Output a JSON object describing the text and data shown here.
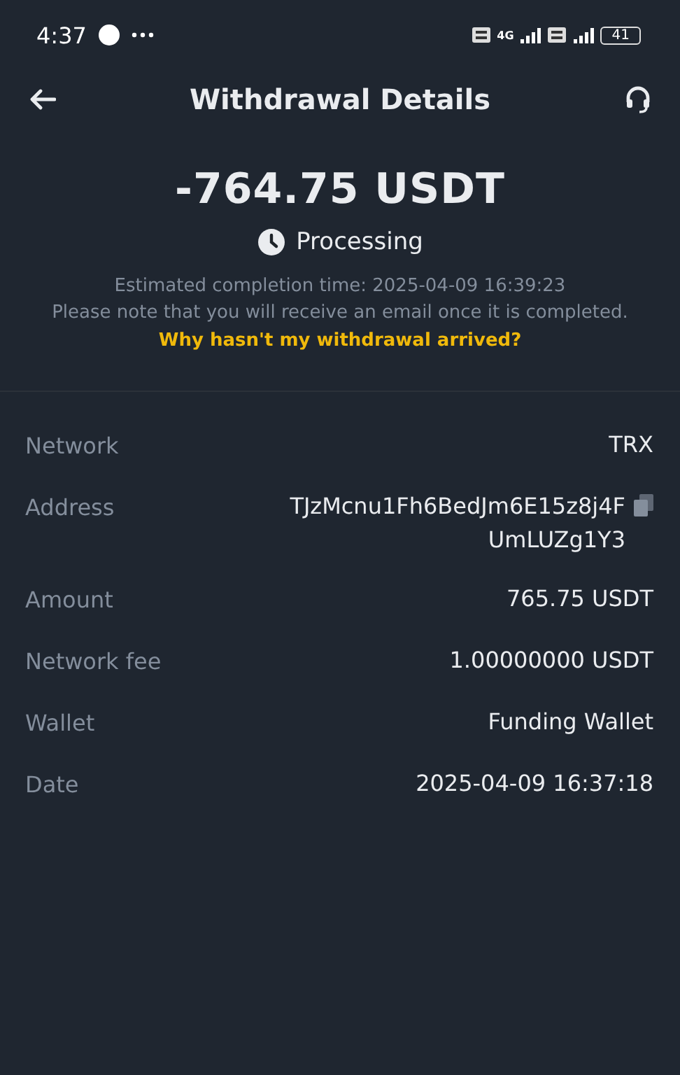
{
  "status_bar": {
    "time": "4:37",
    "network": "4G",
    "battery": "41"
  },
  "header": {
    "title": "Withdrawal Details"
  },
  "summary": {
    "amount": "-764.75 USDT",
    "status": "Processing",
    "estimate": "Estimated completion time: 2025-04-09 16:39:23",
    "note": "Please note that you will receive an email once it is completed.",
    "help_link": "Why hasn't my withdrawal arrived?"
  },
  "details": [
    {
      "label": "Network",
      "value": [
        "TRX"
      ],
      "copyable": false
    },
    {
      "label": "Address",
      "value": [
        "TJzMcnu1Fh6BedJm6E15z8j4F",
        "UmLUZg1Y3"
      ],
      "copyable": true
    },
    {
      "label": "Amount",
      "value": [
        "765.75 USDT"
      ],
      "copyable": false
    },
    {
      "label": "Network fee",
      "value": [
        "1.00000000 USDT"
      ],
      "copyable": false
    },
    {
      "label": "Wallet",
      "value": [
        "Funding Wallet"
      ],
      "copyable": false
    },
    {
      "label": "Date",
      "value": [
        "2025-04-09 16:37:18"
      ],
      "copyable": false
    }
  ]
}
